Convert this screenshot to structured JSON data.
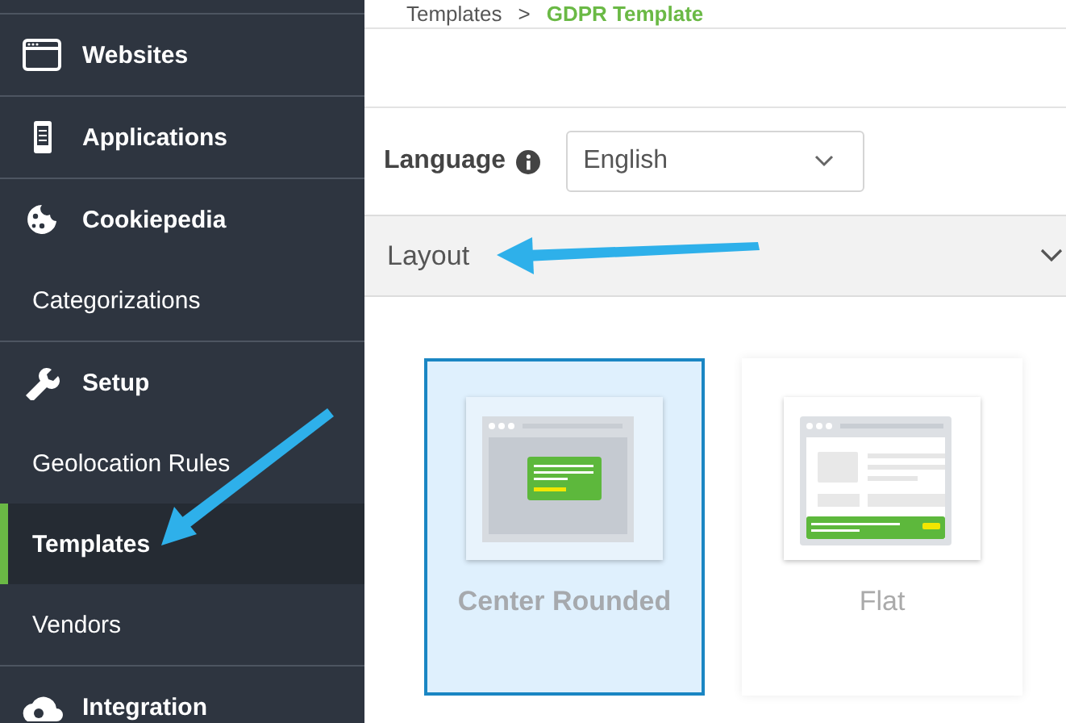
{
  "sidebar": {
    "sections": [
      {
        "label": "Websites",
        "selected": false
      },
      {
        "label": "Applications",
        "selected": false
      },
      {
        "label": "Cookiepedia",
        "selected": false,
        "children": [
          {
            "label": "Categorizations",
            "selected": false
          }
        ]
      },
      {
        "label": "Setup",
        "selected": false,
        "children": [
          {
            "label": "Geolocation Rules",
            "selected": false
          },
          {
            "label": "Templates",
            "selected": true
          },
          {
            "label": "Vendors",
            "selected": false
          }
        ]
      },
      {
        "label": "Integration",
        "selected": false
      }
    ]
  },
  "breadcrumb": {
    "items": [
      {
        "label": "Templates",
        "current": false
      },
      {
        "label": "GDPR Template",
        "current": true
      }
    ],
    "separator": ">"
  },
  "language": {
    "label": "Language",
    "value": "English"
  },
  "layout_section": {
    "title": "Layout",
    "expanded": true,
    "options": [
      {
        "label": "Center Rounded",
        "kind": "centered",
        "selected": true
      },
      {
        "label": "Flat",
        "kind": "bar",
        "selected": false
      }
    ]
  }
}
